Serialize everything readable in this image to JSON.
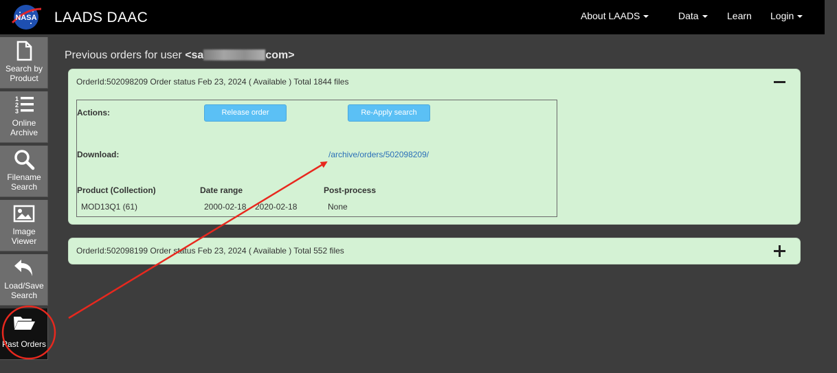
{
  "app": {
    "brand": "LAADS DAAC",
    "logo_text": "NASA"
  },
  "nav": {
    "about": "About LAADS",
    "data": "Data",
    "learn": "Learn",
    "login": "Login"
  },
  "sidebar": {
    "items": [
      {
        "label1": "Search by",
        "label2": "Product",
        "icon": "file-icon"
      },
      {
        "label1": "Online",
        "label2": "Archive",
        "icon": "list-ordered-icon"
      },
      {
        "label1": "Filename",
        "label2": "Search",
        "icon": "search-icon"
      },
      {
        "label1": "Image",
        "label2": "Viewer",
        "icon": "image-icon"
      },
      {
        "label1": "Load/Save",
        "label2": "Search",
        "icon": "undo-icon"
      },
      {
        "label1": "Past Orders",
        "label2": "",
        "icon": "folder-open-icon"
      }
    ]
  },
  "main": {
    "title_prefix": "Previous orders for user",
    "user_start": "<sa",
    "user_end": "com>"
  },
  "orders": [
    {
      "header": "OrderId:502098209 Order status Feb 23, 2024 ( Available ) Total 1844 files",
      "actions_label": "Actions:",
      "release_button": "Release order",
      "reapply_button": "Re-Apply search",
      "download_label": "Download:",
      "download_link": "/archive/orders/502098209/",
      "col_product": "Product (Collection)",
      "col_date": "Date range",
      "col_post": "Post-process",
      "product": "MOD13Q1 (61)",
      "date_start": "2000-02-18",
      "date_end": "2020-02-18",
      "post": "None"
    },
    {
      "header": "OrderId:502098199 Order status Feb 23, 2024 ( Available ) Total 552 files"
    }
  ],
  "colors": {
    "panel_bg": "#d4f2d4",
    "button_bg": "#5bc0f5",
    "link": "#2a6fb8",
    "annotation": "#e8281e"
  }
}
